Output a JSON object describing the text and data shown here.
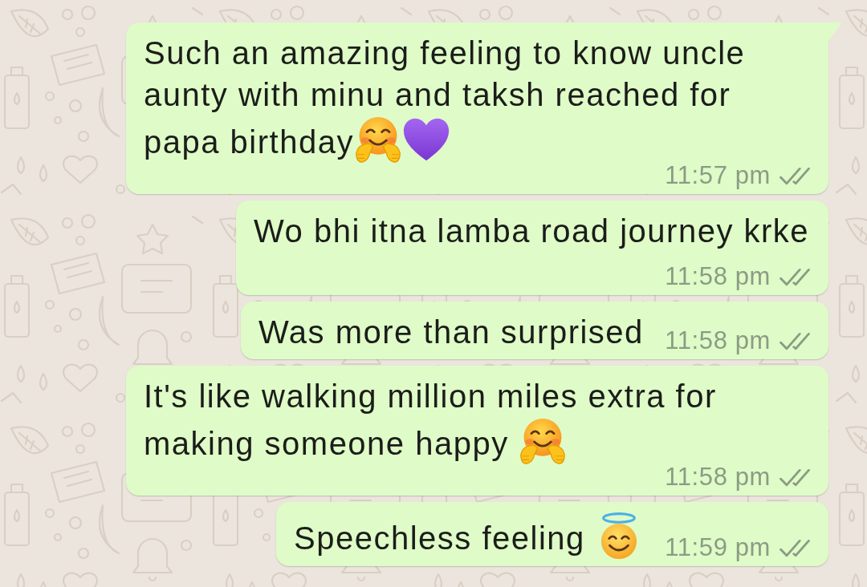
{
  "messages": [
    {
      "text": "Such an amazing feeling to know uncle aunty with minu and taksh reached for papa birthday",
      "emojis": [
        {
          "kind": "hugging-face"
        },
        {
          "kind": "purple-heart"
        }
      ],
      "time": "11:57 pm",
      "read": false,
      "tail": true
    },
    {
      "text": "Wo bhi itna lamba road journey krke",
      "time": "11:58 pm",
      "read": false,
      "tail": false
    },
    {
      "text": "Was more than surprised",
      "time": "11:58 pm",
      "read": false,
      "tail": false
    },
    {
      "text": "It's like walking million miles extra for making someone happy ",
      "emojis": [
        {
          "kind": "hugging-face"
        }
      ],
      "time": "11:58 pm",
      "read": false,
      "tail": false
    },
    {
      "text": "Speechless feeling ",
      "emojis": [
        {
          "kind": "halo-smile"
        }
      ],
      "time": "11:59 pm",
      "read": false,
      "tail": false
    }
  ]
}
